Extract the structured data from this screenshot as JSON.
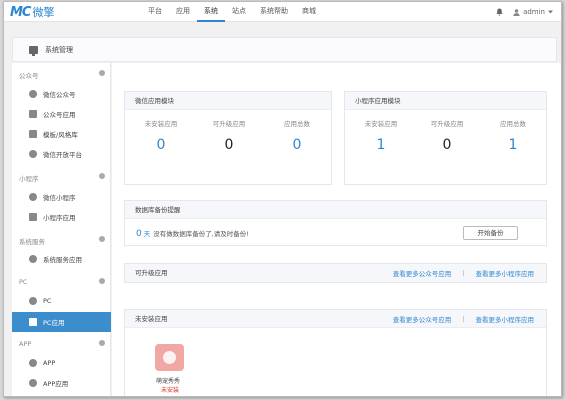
{
  "topbar": {
    "logo_mark": "MC",
    "logo_text": "微擎",
    "nav": [
      "平台",
      "应用",
      "系统",
      "站点",
      "系统帮助",
      "商城"
    ],
    "active_nav_index": 2,
    "user": "admin"
  },
  "page_header": {
    "title": "系统管理"
  },
  "sidebar": {
    "sections": [
      {
        "label": "公众号",
        "items": [
          {
            "label": "微信公众号",
            "icon": "wechat-icon"
          },
          {
            "label": "公众号应用",
            "icon": "app-icon"
          },
          {
            "label": "模板/风格库",
            "icon": "template-icon"
          },
          {
            "label": "微信开放平台",
            "icon": "open-platform-icon"
          }
        ]
      },
      {
        "label": "小程序",
        "items": [
          {
            "label": "微信小程序",
            "icon": "mini-program-icon"
          },
          {
            "label": "小程序应用",
            "icon": "app-icon"
          }
        ]
      },
      {
        "label": "系统服务",
        "items": [
          {
            "label": "系统服务应用",
            "icon": "service-icon"
          }
        ]
      },
      {
        "label": "PC",
        "items": [
          {
            "label": "PC",
            "icon": "pc-icon"
          },
          {
            "label": "PC应用",
            "icon": "pc-app-icon",
            "active": true
          }
        ]
      },
      {
        "label": "APP",
        "items": [
          {
            "label": "APP",
            "icon": "mobile-icon"
          },
          {
            "label": "APP应用",
            "icon": "mobile-app-icon"
          }
        ]
      }
    ]
  },
  "wechat_panel": {
    "title": "微信应用模块",
    "stats": [
      {
        "label": "未安装应用",
        "value": "0",
        "color": "blue"
      },
      {
        "label": "可升级应用",
        "value": "0",
        "color": "dark"
      },
      {
        "label": "应用总数",
        "value": "0",
        "color": "blue"
      }
    ]
  },
  "mini_panel": {
    "title": "小程序应用模块",
    "stats": [
      {
        "label": "未安装应用",
        "value": "1",
        "color": "blue"
      },
      {
        "label": "可升级应用",
        "value": "0",
        "color": "dark"
      },
      {
        "label": "应用总数",
        "value": "1",
        "color": "blue"
      }
    ]
  },
  "backup_panel": {
    "title": "数据库备份提醒",
    "days": "0",
    "unit": "天",
    "message": "没有做数据库备份了,请及时备份!",
    "button": "开始备份"
  },
  "upgrade_panel": {
    "title": "可升级应用",
    "link_official": "查看更多公众号应用",
    "link_mini": "查看更多小程序应用"
  },
  "uninstalled_panel": {
    "title": "未安装应用",
    "link_official": "查看更多公众号应用",
    "link_mini": "查看更多小程序应用",
    "apps": [
      {
        "name": "萌宠秀秀",
        "status": "未安装"
      }
    ]
  },
  "colors": {
    "accent": "#2e86d1",
    "active_sidebar": "#3c8dcc",
    "warning": "#e0302b",
    "app_icon": "#f1a7a4"
  }
}
